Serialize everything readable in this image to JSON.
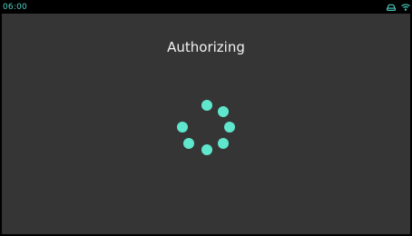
{
  "status_bar": {
    "time": "06:00",
    "icons": [
      "car-icon",
      "wifi-icon"
    ],
    "accent_color": "#4fd1c5"
  },
  "screen": {
    "title": "Authorizing",
    "background_color": "#353535"
  },
  "spinner": {
    "dot_color": "#5fe6cc",
    "dot_count": 8
  }
}
